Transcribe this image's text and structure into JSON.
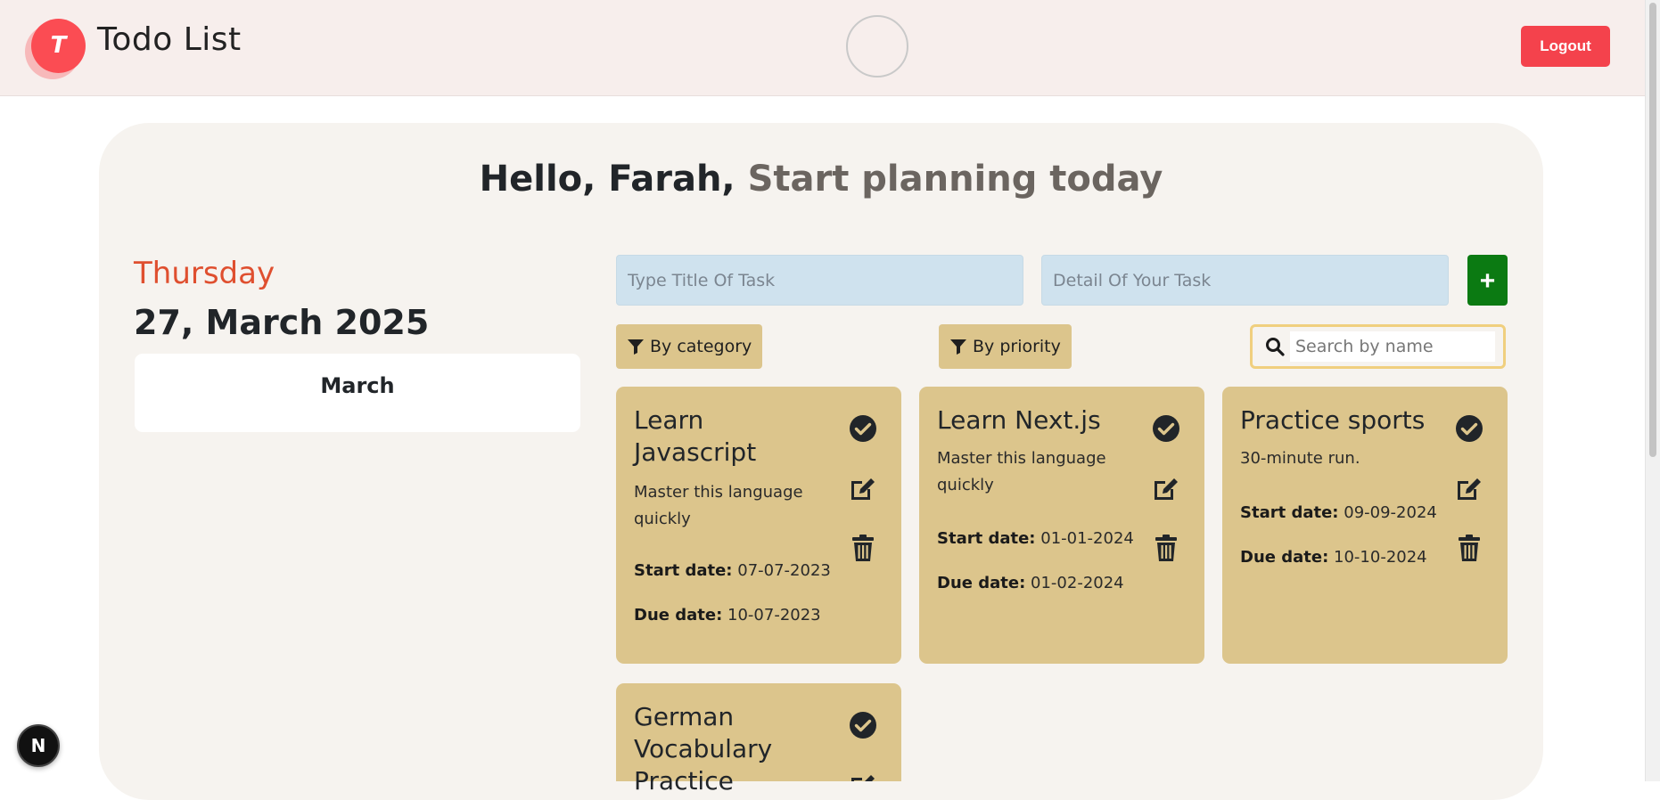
{
  "header": {
    "logo_letter": "T",
    "title": "Todo List",
    "logout_label": "Logout"
  },
  "greeting": {
    "hello": "Hello, Farah,",
    "sub": "Start planning today"
  },
  "date_panel": {
    "day": "Thursday",
    "date": "27, March 2025",
    "calendar_month": "March"
  },
  "form": {
    "title_placeholder": "Type Title Of Task",
    "detail_placeholder": "Detail Of Your Task",
    "add_label": "+"
  },
  "filters": {
    "category_label": "By category",
    "priority_label": "By priority",
    "search_placeholder": "Search by name"
  },
  "tasks": [
    {
      "title": "Learn Javascript",
      "detail": "Master this language quickly",
      "start_label": "Start date:",
      "start": "07-07-2023",
      "due_label": "Due date:",
      "due": "10-07-2023"
    },
    {
      "title": "Learn Next.js",
      "detail": "Master this language quickly",
      "start_label": "Start date:",
      "start": "01-01-2024",
      "due_label": "Due date:",
      "due": "01-02-2024"
    },
    {
      "title": "Practice sports",
      "detail": "30-minute run.",
      "start_label": "Start date:",
      "start": "09-09-2024",
      "due_label": "Due date:",
      "due": "10-10-2024"
    },
    {
      "title": "German Vocabulary Practice",
      "detail": "",
      "start_label": "",
      "start": "",
      "due_label": "",
      "due": ""
    }
  ],
  "dev_badge": "N",
  "colors": {
    "accent": "#fb4c53",
    "logout": "#f4424c",
    "day": "#df4f2f",
    "card": "#dcc58c",
    "add": "#0b7a12",
    "input": "#cfe2ee",
    "search_border": "#f0cf7e"
  }
}
